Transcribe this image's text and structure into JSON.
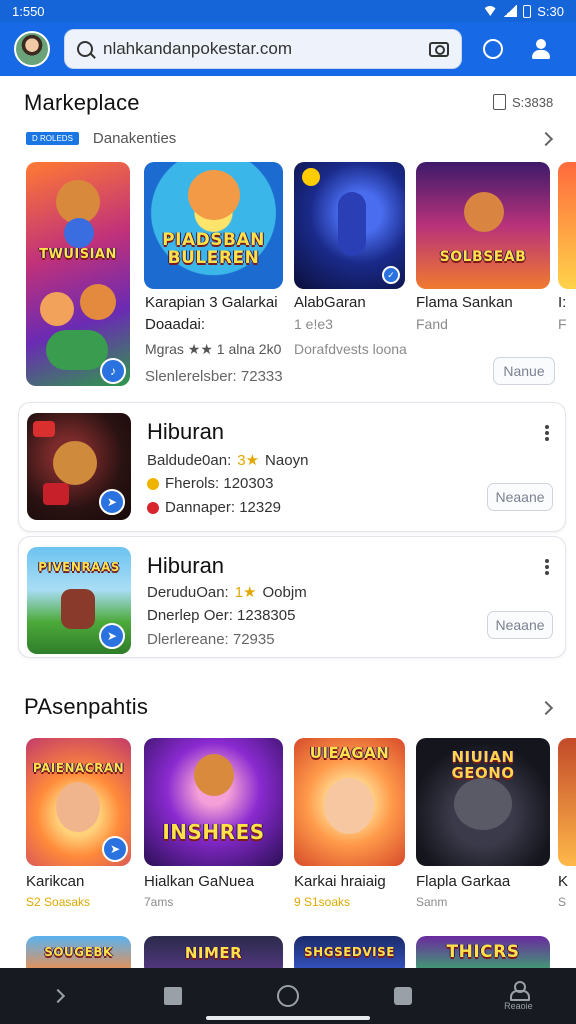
{
  "status_bar": {
    "time": "1:550",
    "right_text": "S:30"
  },
  "app_bar": {
    "search_value": "nlahkandanpokestar.com",
    "icons": [
      "avatar",
      "search-icon",
      "camera-icon",
      "chat-icon",
      "user-icon"
    ]
  },
  "marketplace": {
    "title": "Markeplace",
    "count": "S:3838",
    "badge": "D ROLEDS",
    "subtitle": "Danakenties",
    "featured": {
      "art_label": "TWUISIAN",
      "seller_line": "Slenlerelsber: 72333"
    },
    "tiles": [
      {
        "art_label": "PIADSBAN BULEREN",
        "title": "Karapian 3 Galarkai",
        "subtitle": "Doaadai:",
        "meta": "Mgras ★★ 1 alna 2k0"
      },
      {
        "title": "AlabGaran",
        "subtitle": "1 e!e3",
        "meta": "Dorafdvests loona"
      },
      {
        "art_label": "SOLBSEAB",
        "title": "Flama Sankan",
        "subtitle": "Fand",
        "action": "Nanue"
      },
      {
        "title": "I:",
        "subtitle": "F"
      }
    ]
  },
  "list": [
    {
      "art_label": "",
      "title": "Hiburan",
      "line1_prefix": "Baldude0an:",
      "line1_rating": "3★",
      "line1_suffix": "Naoyn",
      "line2": "Fherols: 120303",
      "line3": "Dannaper: 12329",
      "action": "Neaane"
    },
    {
      "art_label": "PIVENRAAS",
      "title": "Hiburan",
      "line1_prefix": "DeruduOan:",
      "line1_rating": "1★",
      "line1_suffix": "Oobjm",
      "line2": "Dnerlep Oer: 1238305",
      "line3": "Dlerlereane: 72935",
      "action": "Neaane"
    }
  ],
  "section2": {
    "title": "PAsenpahtis",
    "tiles": [
      {
        "art_label": "PAIENACRAN",
        "title": "Karikcan",
        "subtitle": "S2 Soasaks"
      },
      {
        "art_label": "INSHRES",
        "title": "Hialkan GaNuea",
        "subtitle": "7ams"
      },
      {
        "art_label": "UIEAGAN",
        "title": "Karkai hraiaig",
        "subtitle": "9 S1soaks"
      },
      {
        "art_label": "NIUIAN GEONO",
        "title": "Flapla Garkaa",
        "subtitle": "Sanm"
      },
      {
        "title": "K",
        "subtitle": "S"
      }
    ]
  },
  "bottom_row": [
    {
      "art_label": "SOUGEBK"
    },
    {
      "art_label": "NIMER"
    },
    {
      "art_label": "SHGSEDVISE"
    },
    {
      "art_label": "THICRS"
    }
  ],
  "nav": {
    "profile_label": "Reaoie"
  },
  "colors": {
    "accent": "#1769e6",
    "star": "#e0a800",
    "nav_bg": "#171a20"
  }
}
